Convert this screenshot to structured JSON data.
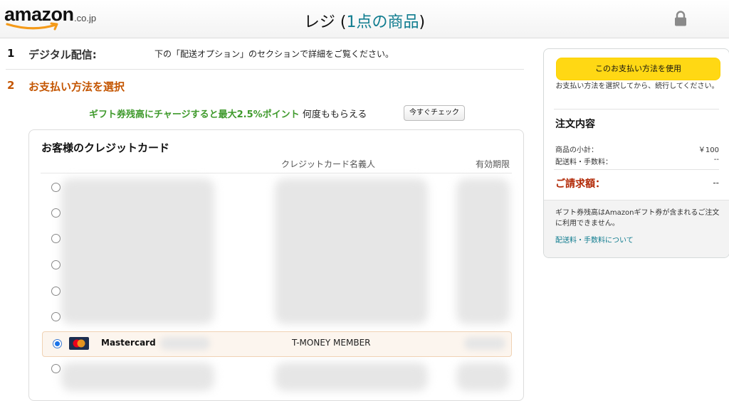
{
  "header": {
    "logo_text": "amazon",
    "logo_tld": ".co.jp",
    "title_prefix": "レジ",
    "title_open": "(",
    "title_count": "1点の商品",
    "title_close": ")",
    "lock_icon": "lock-icon"
  },
  "step1": {
    "number": "1",
    "title": "デジタル配信:",
    "description": "下の「配送オプション」のセクションで詳細をご覧ください。"
  },
  "step2": {
    "number": "2",
    "title": "お支払い方法を選択"
  },
  "promo": {
    "highlight": "ギフト券残高にチャージすると最大2.5%ポイント",
    "suffix": "何度ももらえる",
    "button": "今すぐチェック"
  },
  "cards": {
    "section_title": "お客様のクレジットカード",
    "col_name": "クレジットカード名義人",
    "col_expiry": "有効期限",
    "selected": {
      "brand": "Mastercard",
      "holder": "T-MONEY MEMBER",
      "icon": "mastercard-icon"
    }
  },
  "sidebar": {
    "use_button": "このお支払い方法を使用",
    "use_note": "お支払い方法を選択してから、続行してください。",
    "summary_title": "注文内容",
    "subtotal_label": "商品の小計：",
    "subtotal_value": "￥100",
    "shipping_label": "配送料・手数料：",
    "shipping_value": "--",
    "total_label": "ご請求額：",
    "total_value": "--",
    "footer_note": "ギフト券残高はAmazonギフト券が含まれるご注文に利用できません。",
    "footer_link": "配送料・手数料について"
  },
  "colors": {
    "accent_orange": "#c45500",
    "promo_green": "#3f9a2c",
    "button_yellow": "#ffd814",
    "link_teal": "#0f7c8f",
    "total_red": "#b12704"
  }
}
